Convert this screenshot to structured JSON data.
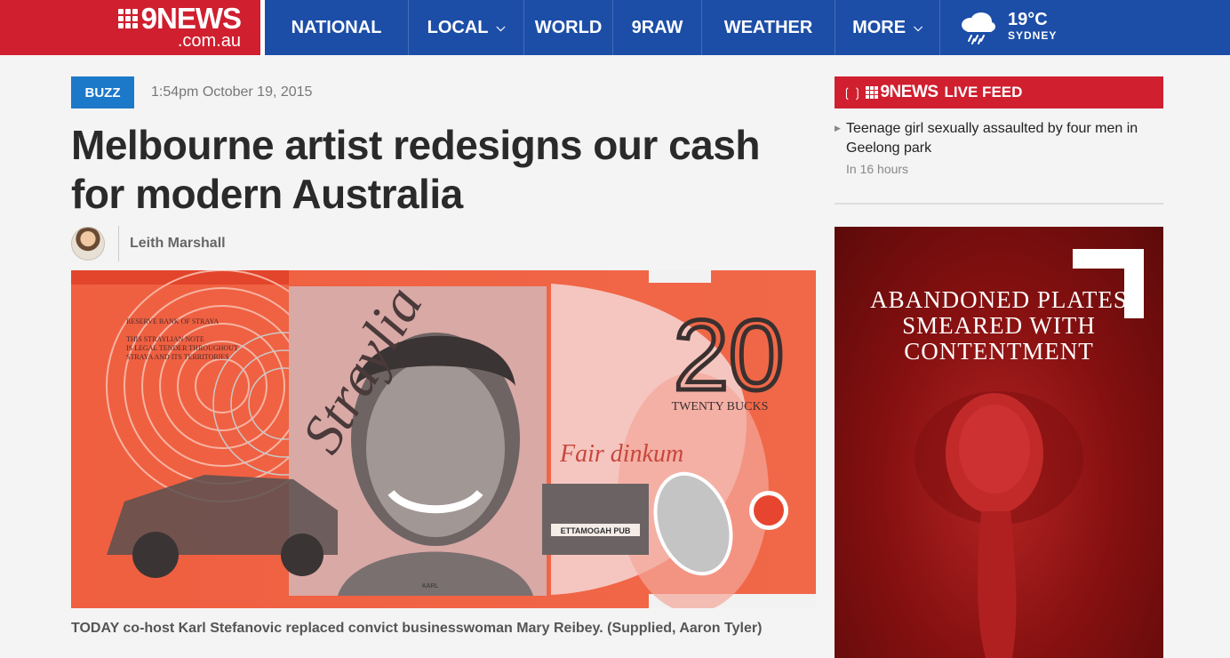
{
  "brand": {
    "logo_text": "NEWS",
    "logo_number": "9",
    "domain": ".com.au"
  },
  "nav": {
    "items": [
      {
        "label": "NATIONAL",
        "dropdown": false
      },
      {
        "label": "LOCAL",
        "dropdown": true
      },
      {
        "label": "WORLD",
        "dropdown": false
      },
      {
        "label": "9RAW",
        "dropdown": false
      },
      {
        "label": "WEATHER",
        "dropdown": false
      },
      {
        "label": "MORE",
        "dropdown": true
      }
    ],
    "caret": "⌄"
  },
  "weather": {
    "temperature": "19°C",
    "city": "SYDNEY",
    "icon": "rain-cloud-icon"
  },
  "article": {
    "tag": "BUZZ",
    "timestamp": "1:54pm October 19, 2015",
    "headline": "Melbourne artist redesigns our cash for modern Australia",
    "author": "Leith Marshall",
    "caption": "TODAY co-host Karl Stefanovic replaced convict businesswoman Mary Reibey. (Supplied, Aaron Tyler)",
    "image": {
      "bank_text": [
        "RESERVE BANK OF STRAYA",
        "THIS STRAYLIAN NOTE",
        "IS LEGAL TENDER THROUGHOUT",
        "STRAYA AND ITS TERRITORIES"
      ],
      "script": "Straylia",
      "denomination": "20",
      "denomination_words": "TWENTY BUCKS",
      "motto": "Fair dinkum",
      "pub_sign": "ETTAMOGAH PUB",
      "portrait_label": "KARL"
    }
  },
  "sidebar": {
    "livefeed": {
      "brand": "NEWS",
      "brand_number": "9",
      "label": "LIVE FEED",
      "items": [
        {
          "title": "Teenage girl sexually assaulted by four men in Geelong park",
          "time": "In 16 hours"
        }
      ]
    },
    "ad": {
      "lines": [
        "ABANDONED PLATES",
        "SMEARED WITH",
        "CONTENTMENT"
      ]
    }
  },
  "colors": {
    "brand_red": "#d01f2f",
    "nav_blue": "#1c4ea8",
    "tag_blue": "#1c78c9",
    "ad_red": "#861010"
  }
}
